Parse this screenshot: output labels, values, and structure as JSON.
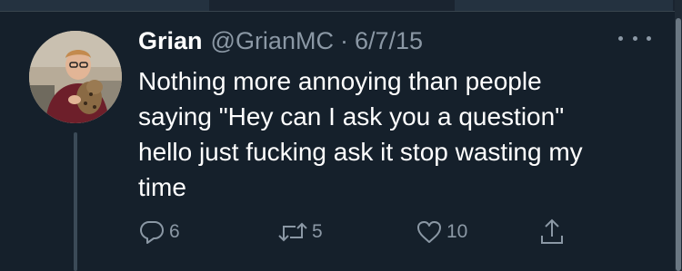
{
  "tweet": {
    "author_name": "Grian",
    "handle": "@GrianMC",
    "separator": "·",
    "date": "6/7/15",
    "text": "Nothing more annoying than people\nsaying \"Hey can I ask you a question\"\nhello just fucking ask it stop wasting my\ntime",
    "reply_count": "6",
    "retweet_count": "5",
    "like_count": "10"
  },
  "icons": {
    "more": "more-horizontal-icon",
    "reply": "reply-bubble-icon",
    "retweet": "retweet-icon",
    "like": "heart-icon",
    "share": "share-upload-icon"
  },
  "colors": {
    "background": "#15202b",
    "text_primary": "#ffffff",
    "text_secondary": "#8b98a5",
    "thread_line": "#3b4a57"
  }
}
